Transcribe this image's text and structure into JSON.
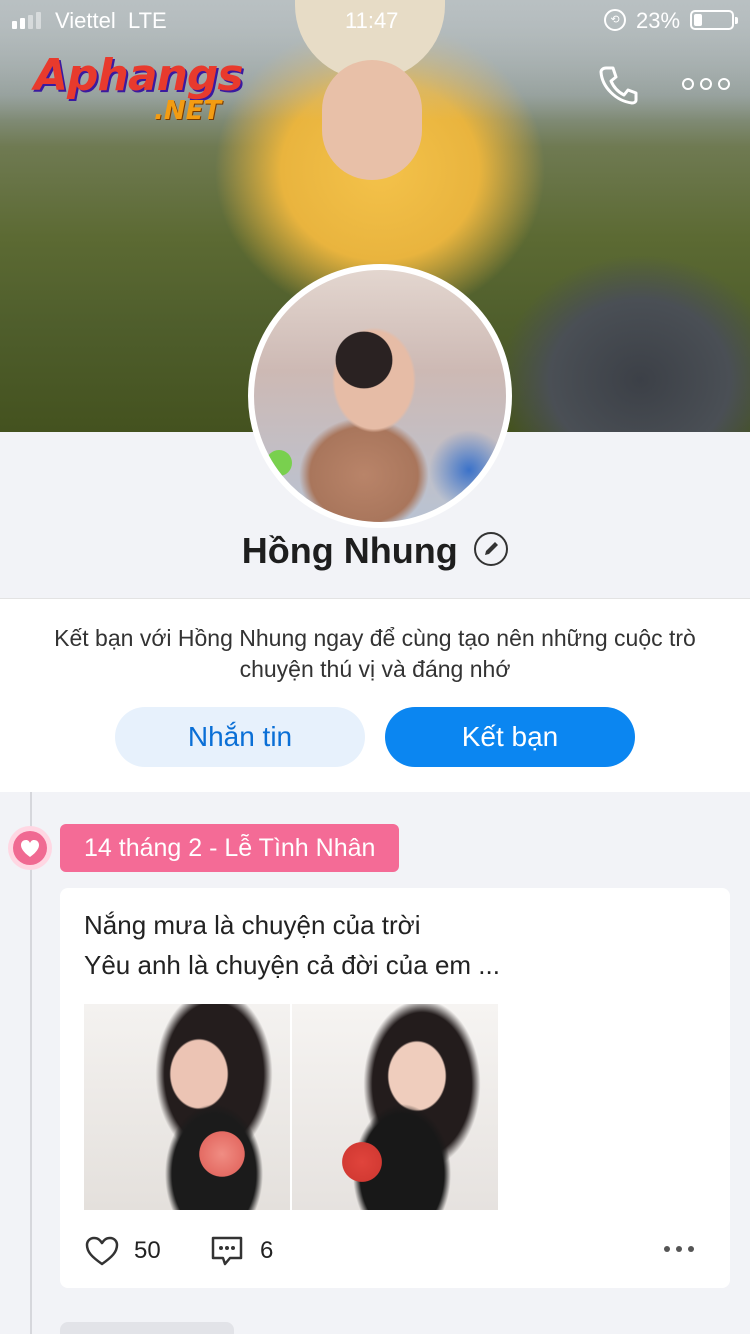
{
  "status_bar": {
    "carrier": "Viettel",
    "network": "LTE",
    "time": "11:47",
    "battery_percent": "23%",
    "battery_level": 0.23
  },
  "watermark": {
    "word": "Aphangs",
    "tld": ".NET"
  },
  "header": {
    "call_icon": "phone-icon",
    "more_icon": "more-horizontal-icon"
  },
  "profile": {
    "name": "Hồng Nhung",
    "edit_icon": "pencil-icon"
  },
  "intro": {
    "message": "Kết bạn với Hồng Nhung ngay để cùng tạo nên những cuộc trò chuyện thú vị và đáng nhớ",
    "message_button": "Nhắn tin",
    "add_friend_button": "Kết bạn"
  },
  "timeline": {
    "tag": "14 tháng 2 - Lễ Tình Nhân",
    "post": {
      "line1": "Nắng mưa là chuyện của trời",
      "line2": "Yêu anh là chuyện cả đời của em ...",
      "like_count": "50",
      "comment_count": "6"
    }
  },
  "colors": {
    "accent_blue": "#0b86f1",
    "light_blue": "#e7f1fc",
    "tag_pink": "#f46b96",
    "background": "#f2f3f7"
  }
}
